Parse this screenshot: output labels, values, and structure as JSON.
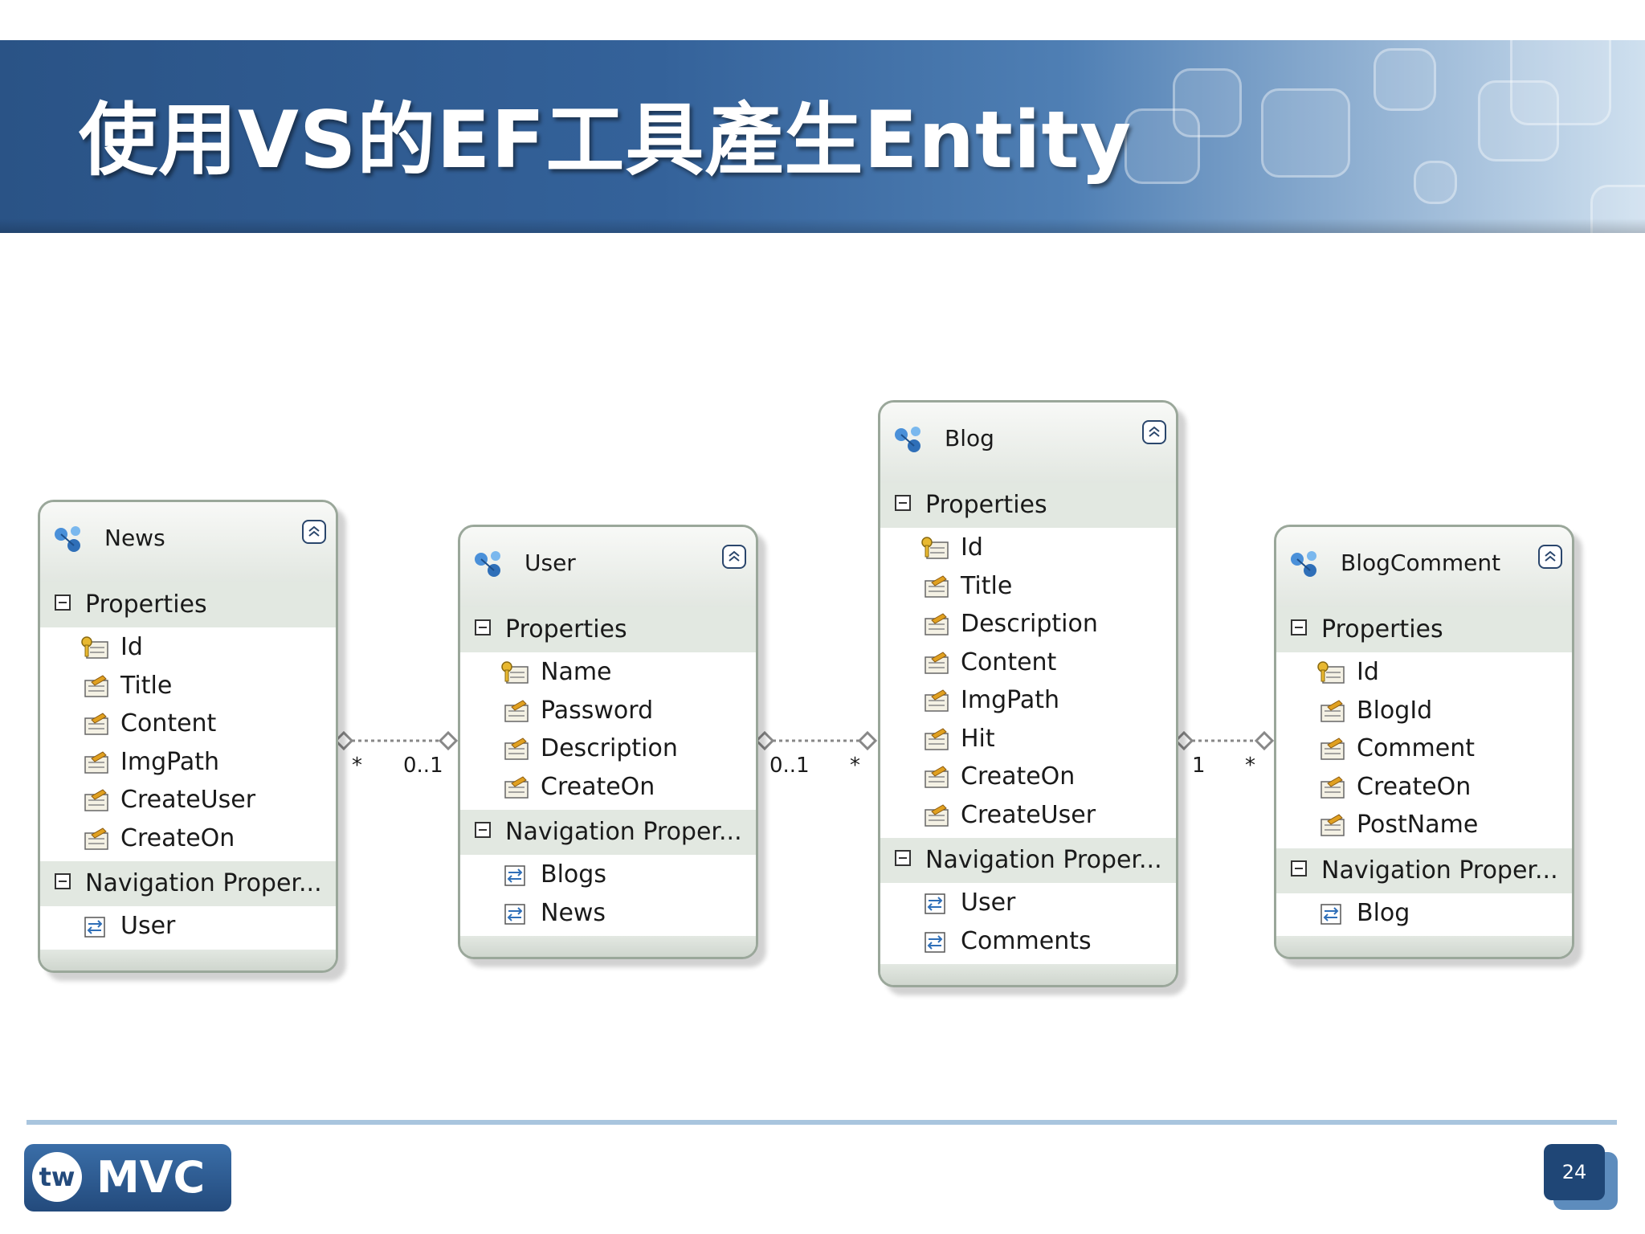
{
  "slide": {
    "title": "使用VS的EF工具產生Entity",
    "page_number": "24"
  },
  "logo": {
    "tw": "tw",
    "mvc": "MVC"
  },
  "icons": {
    "entity": "entity-type-icon",
    "key_property": "key-property-icon",
    "property": "scalar-property-icon",
    "navigation": "navigation-property-icon",
    "collapse": "collapse-chevron-icon",
    "section_toggle": "minus-toggle-icon"
  },
  "colors": {
    "banner": "#2a5386",
    "entity_border": "#9aa79a",
    "entity_fill": "#edf0ec",
    "footer_line": "#a9c5de"
  },
  "entities": [
    {
      "name": "News",
      "properties_label": "Properties",
      "properties": [
        {
          "name": "Id",
          "key": true
        },
        {
          "name": "Title",
          "key": false
        },
        {
          "name": "Content",
          "key": false
        },
        {
          "name": "ImgPath",
          "key": false
        },
        {
          "name": "CreateUser",
          "key": false
        },
        {
          "name": "CreateOn",
          "key": false
        }
      ],
      "nav_label": "Navigation Proper...",
      "navigation": [
        "User"
      ]
    },
    {
      "name": "User",
      "properties_label": "Properties",
      "properties": [
        {
          "name": "Name",
          "key": true
        },
        {
          "name": "Password",
          "key": false
        },
        {
          "name": "Description",
          "key": false
        },
        {
          "name": "CreateOn",
          "key": false
        }
      ],
      "nav_label": "Navigation Proper...",
      "navigation": [
        "Blogs",
        "News"
      ]
    },
    {
      "name": "Blog",
      "properties_label": "Properties",
      "properties": [
        {
          "name": "Id",
          "key": true
        },
        {
          "name": "Title",
          "key": false
        },
        {
          "name": "Description",
          "key": false
        },
        {
          "name": "Content",
          "key": false
        },
        {
          "name": "ImgPath",
          "key": false
        },
        {
          "name": "Hit",
          "key": false
        },
        {
          "name": "CreateOn",
          "key": false
        },
        {
          "name": "CreateUser",
          "key": false
        }
      ],
      "nav_label": "Navigation Proper...",
      "navigation": [
        "User",
        "Comments"
      ]
    },
    {
      "name": "BlogComment",
      "properties_label": "Properties",
      "properties": [
        {
          "name": "Id",
          "key": true
        },
        {
          "name": "BlogId",
          "key": false
        },
        {
          "name": "Comment",
          "key": false
        },
        {
          "name": "CreateOn",
          "key": false
        },
        {
          "name": "PostName",
          "key": false
        }
      ],
      "nav_label": "Navigation Proper...",
      "navigation": [
        "Blog"
      ]
    }
  ],
  "associations": [
    {
      "from": "News",
      "to": "User",
      "from_mult": "*",
      "to_mult": "0..1"
    },
    {
      "from": "User",
      "to": "Blog",
      "from_mult": "0..1",
      "to_mult": "*"
    },
    {
      "from": "Blog",
      "to": "BlogComment",
      "from_mult": "1",
      "to_mult": "*"
    }
  ]
}
